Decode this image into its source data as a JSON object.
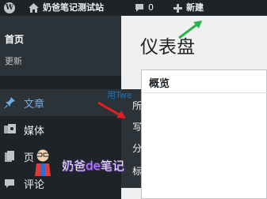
{
  "admin_bar": {
    "site_name": "奶爸笔记测试站",
    "comments_count": "0",
    "new_label": "新建"
  },
  "sidebar": {
    "dashboard_items": [
      "首页",
      "更新"
    ],
    "menu": [
      {
        "label": "文章"
      },
      {
        "label": "媒体"
      },
      {
        "label": "页"
      },
      {
        "label": "评论"
      }
    ]
  },
  "submenu": {
    "items": [
      "所有文章",
      "写文章",
      "分类目录",
      "标签"
    ]
  },
  "main": {
    "page_title": "仪表盘",
    "panel_title": "概览",
    "panel_tail_text": "用Twe"
  },
  "watermark": {
    "text_left": "奶爸",
    "text_mid": "de",
    "text_right": "笔记"
  },
  "colors": {
    "admin_bar_bg": "#1d2327",
    "sidebar_bg": "#1d2327",
    "submenu_bg": "#2c3338",
    "active_blue": "#72aee6",
    "arrow_red": "#e02020",
    "arrow_green": "#2ab24a"
  }
}
